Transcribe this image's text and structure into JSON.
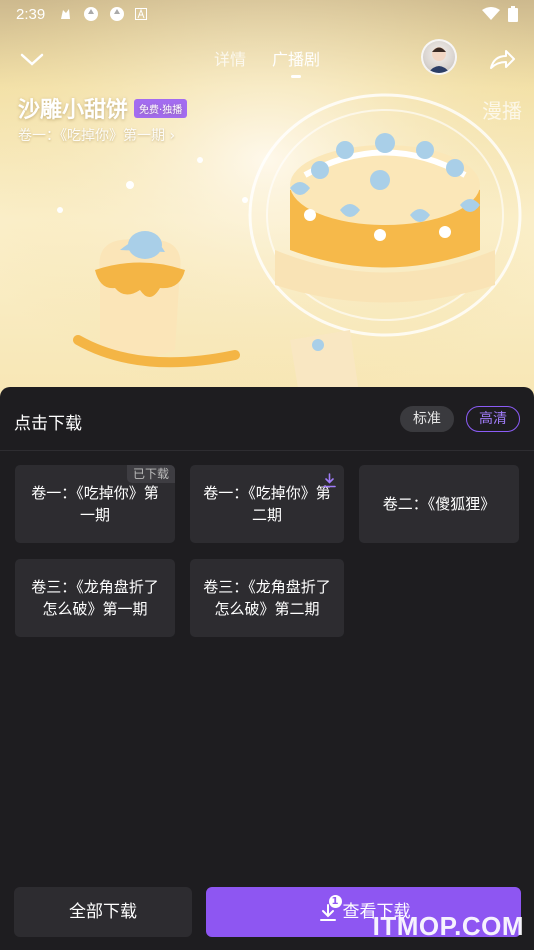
{
  "status_bar": {
    "time": "2:39"
  },
  "nav": {
    "tabs": [
      {
        "label": "详情"
      },
      {
        "label": "广播剧"
      }
    ],
    "active_tab": "广播剧"
  },
  "drama": {
    "title": "沙雕小甜饼",
    "badge": "免费·独播",
    "subtitle": "卷一：《吃掉你》第一期 ›",
    "corner_text": "漫播"
  },
  "sheet": {
    "title": "点击下载",
    "quality": {
      "options": [
        "标准",
        "高清"
      ],
      "selected": "高清"
    },
    "episodes": [
      {
        "label": "卷一：《吃掉你》第一期",
        "status_tag": "已下载"
      },
      {
        "label": "卷一：《吃掉你》第二期",
        "status_icon": "download-icon"
      },
      {
        "label": "卷二：《傻狐狸》"
      },
      {
        "label": "卷三：《龙角盘折了怎么破》第一期"
      },
      {
        "label": "卷三：《龙角盘折了怎么破》第二期"
      }
    ],
    "buttons": {
      "download_all": "全部下载",
      "view_downloads": "查看下载",
      "view_downloads_count": "1"
    }
  },
  "watermark": "ITMOP.COM",
  "colors": {
    "accent": "#8e56f2",
    "badge": "#a36cf0",
    "sheet_bg": "#1e1d20",
    "card_bg": "#2d2c30"
  }
}
